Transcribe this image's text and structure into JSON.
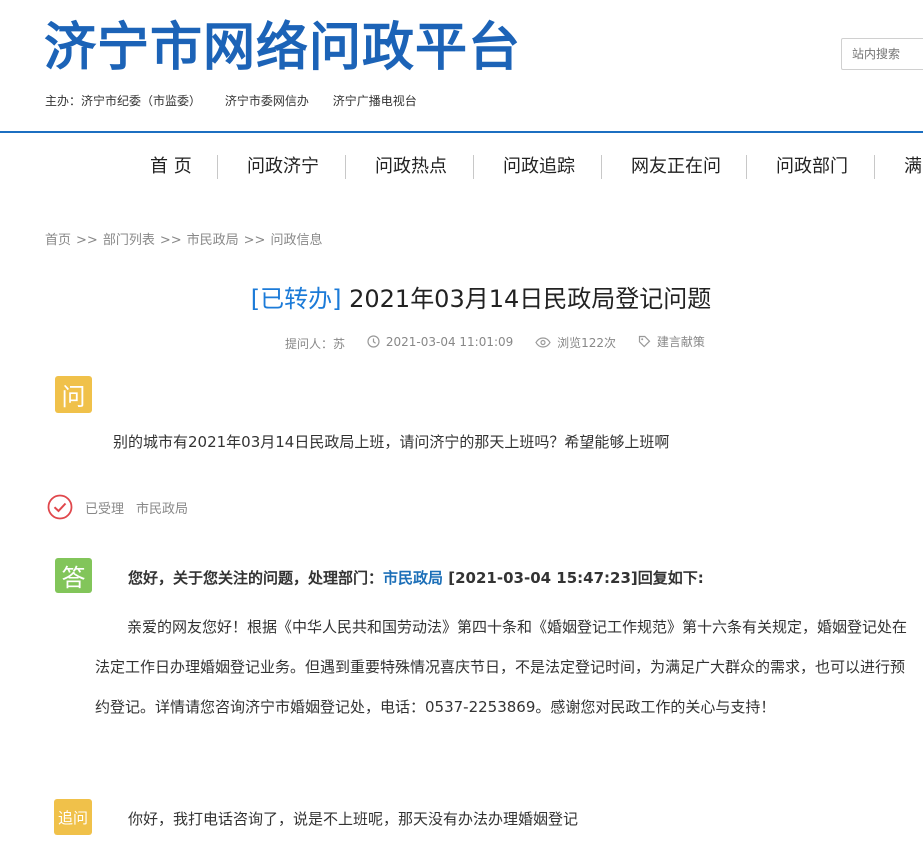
{
  "header": {
    "site_title": "济宁市网络问政平台",
    "sponsors": [
      "主办：济宁市纪委（市监委）",
      "济宁市委网信办",
      "济宁广播电视台"
    ],
    "search_placeholder": "站内搜索"
  },
  "nav": {
    "items": [
      "首 页",
      "问政济宁",
      "问政热点",
      "问政追踪",
      "网友正在问",
      "问政部门",
      "满"
    ]
  },
  "breadcrumb": [
    "首页",
    "部门列表",
    "市民政局",
    "问政信息"
  ],
  "breadcrumb_sep": ">>",
  "article": {
    "status": "[已转办]",
    "title": "2021年03月14日民政局登记问题",
    "meta": {
      "asker": "提问人：苏",
      "datetime": "2021-03-04 11:01:09",
      "views": "浏览122次",
      "category": "建言献策"
    }
  },
  "question": {
    "badge": "问",
    "text": "别的城市有2021年03月14日民政局上班，请问济宁的那天上班吗？希望能够上班啊"
  },
  "status_row": {
    "label": "已受理",
    "department": "市民政局"
  },
  "answer": {
    "badge": "答",
    "head_prefix": "您好，关于您关注的问题，处理部门：",
    "department": "市民政局",
    "head_suffix": "[2021-03-04 15:47:23]回复如下:",
    "body": "亲爱的网友您好！根据《中华人民共和国劳动法》第四十条和《婚姻登记工作规范》第十六条有关规定，婚姻登记处在法定工作日办理婚姻登记业务。但遇到重要特殊情况喜庆节日，不是法定登记时间，为满足广大群众的需求，也可以进行预约登记。详情请您咨询济宁市婚姻登记处，电话：0537-2253869。感谢您对民政工作的关心与支持！"
  },
  "followup": {
    "badge": "追问",
    "text": "你好，我打电话咨询了，说是不上班呢，那天没有办法办理婚姻登记"
  },
  "colors": {
    "brand_blue": "#1c63b7",
    "status_blue": "#1c7bd8",
    "badge_yellow": "#f0c14a",
    "badge_green": "#82c55a",
    "check_red": "#e0474c"
  }
}
